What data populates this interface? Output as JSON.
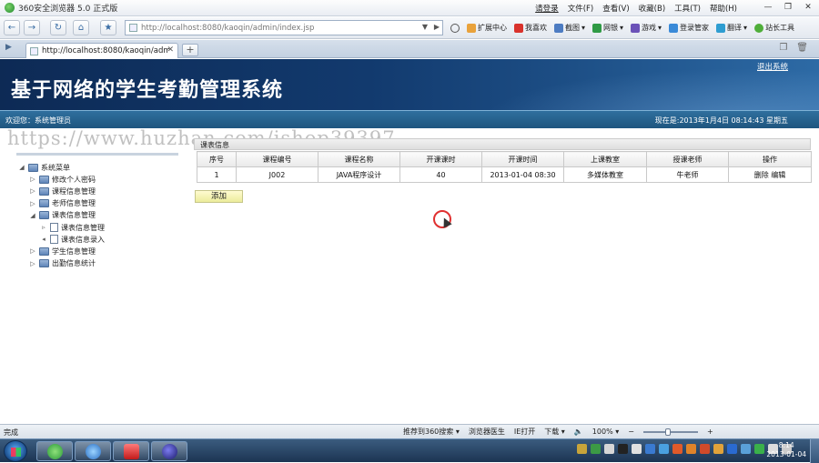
{
  "browser": {
    "title": "360安全浏览器 5.0 正式版",
    "menus": [
      "文件(F)",
      "查看(V)",
      "收藏(B)",
      "工具(T)",
      "帮助(H)"
    ],
    "login": "请登录",
    "address": "http://localhost:8080/kaoqin/admin/index.jsp",
    "tab_label": "http://localhost:8080/kaoqin/adm...",
    "toolbar_items": [
      "扩展中心",
      "我喜欢",
      "截图",
      "网银",
      "游戏",
      "登录管家",
      "翻译",
      "站长工具"
    ],
    "status": "完成",
    "status_items": [
      "推荐到360搜索",
      "浏览器医生",
      "IE打开",
      "下载",
      "100%"
    ]
  },
  "page": {
    "system_title": "基于网络的学生考勤管理系统",
    "logout": "退出系统",
    "welcome": "欢迎您：系统管理员",
    "now": "现在是:2013年1月4日  08:14:43 星期五",
    "watermark": "https://www.huzhan.com/ishop39397",
    "panel_title": "课表信息",
    "add_button": "添加"
  },
  "tree": [
    {
      "label": "系统菜单",
      "level": 0,
      "toggle": "◢",
      "icon": "folder"
    },
    {
      "label": "修改个人密码",
      "level": 1,
      "toggle": "▷",
      "icon": "folder"
    },
    {
      "label": "课程信息管理",
      "level": 1,
      "toggle": "▷",
      "icon": "folder"
    },
    {
      "label": "老师信息管理",
      "level": 1,
      "toggle": "▷",
      "icon": "folder"
    },
    {
      "label": "课表信息管理",
      "level": 1,
      "toggle": "◢",
      "icon": "folder"
    },
    {
      "label": "课表信息管理",
      "level": 2,
      "toggle": "▹",
      "icon": "doc"
    },
    {
      "label": "课表信息录入",
      "level": 2,
      "toggle": "◂",
      "icon": "doc"
    },
    {
      "label": "学生信息管理",
      "level": 1,
      "toggle": "▷",
      "icon": "folder"
    },
    {
      "label": "出勤信息统计",
      "level": 1,
      "toggle": "▷",
      "icon": "folder"
    }
  ],
  "table": {
    "headers": [
      "序号",
      "课程编号",
      "课程名称",
      "开课课时",
      "开课时间",
      "上课教室",
      "授课老师",
      "操作"
    ],
    "rows": [
      {
        "index": "1",
        "code": "J002",
        "name": "JAVA程序设计",
        "hours": "40",
        "time": "2013-01-04 08:30",
        "room": "多媒体教室",
        "teacher": "牛老师",
        "delete": "删除",
        "edit": "编辑"
      }
    ]
  },
  "taskbar": {
    "clock_time": "8:14",
    "clock_date": "2013-01-04"
  }
}
